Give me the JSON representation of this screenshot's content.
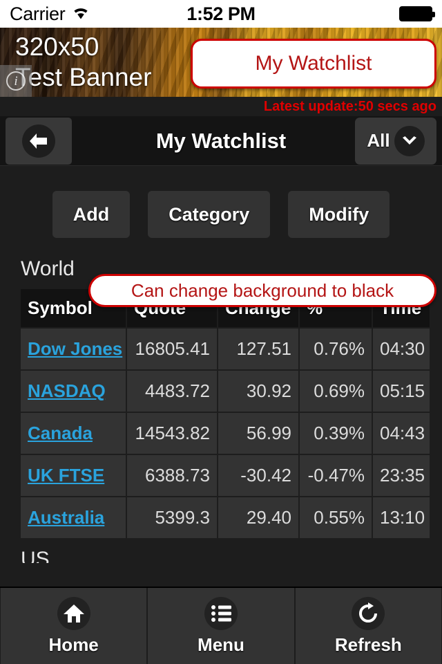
{
  "status_bar": {
    "carrier": "Carrier",
    "time": "1:52 PM",
    "wifi_icon": "wifi-icon",
    "battery_icon": "battery-full-icon"
  },
  "ad_banner": {
    "line1": "320x50",
    "line2": "Test Banner",
    "text": "320x50\nTest Banner",
    "info_icon": "info-icon",
    "info_glyph": "i"
  },
  "callouts": {
    "title_bubble": "My Watchlist",
    "background_bubble": "Can change background to black"
  },
  "update": {
    "text": "Latest update:50 secs ago",
    "color": "#e00000"
  },
  "navbar": {
    "back_icon": "arrow-left-icon",
    "title": "My Watchlist",
    "filter_label": "All",
    "filter_icon": "chevron-down-icon"
  },
  "actions": [
    {
      "label": "Add",
      "name": "add-button"
    },
    {
      "label": "Category",
      "name": "category-button"
    },
    {
      "label": "Modify",
      "name": "modify-button"
    }
  ],
  "sections": [
    {
      "title": "World"
    },
    {
      "title": "US"
    }
  ],
  "table": {
    "headers": [
      "Symbol",
      "Quote",
      "Change",
      "%",
      "Time"
    ],
    "rows": [
      {
        "symbol": "Dow Jones",
        "quote": "16805.41",
        "change": "127.51",
        "percent": "0.76%",
        "time": "04:30",
        "direction": "up"
      },
      {
        "symbol": "NASDAQ",
        "quote": "4483.72",
        "change": "30.92",
        "percent": "0.69%",
        "time": "05:15",
        "direction": "up"
      },
      {
        "symbol": "Canada",
        "quote": "14543.82",
        "change": "56.99",
        "percent": "0.39%",
        "time": "04:43",
        "direction": "up"
      },
      {
        "symbol": "UK FTSE",
        "quote": "6388.73",
        "change": "-30.42",
        "percent": "-0.47%",
        "time": "23:35",
        "direction": "down"
      },
      {
        "symbol": "Australia",
        "quote": "5399.3",
        "change": "29.40",
        "percent": "0.55%",
        "time": "13:10",
        "direction": "up"
      }
    ]
  },
  "tabbar": [
    {
      "label": "Home",
      "icon": "home-icon",
      "name": "tab-home"
    },
    {
      "label": "Menu",
      "icon": "list-icon",
      "name": "tab-menu"
    },
    {
      "label": "Refresh",
      "icon": "refresh-icon",
      "name": "tab-refresh"
    }
  ],
  "colors": {
    "up": "#0a8a0a",
    "down": "#e01b1b",
    "link": "#2aa3dd",
    "accent_red": "#cc0000",
    "background": "#1d1d1d",
    "row_bg": "#333333",
    "header_bg": "#121212"
  }
}
